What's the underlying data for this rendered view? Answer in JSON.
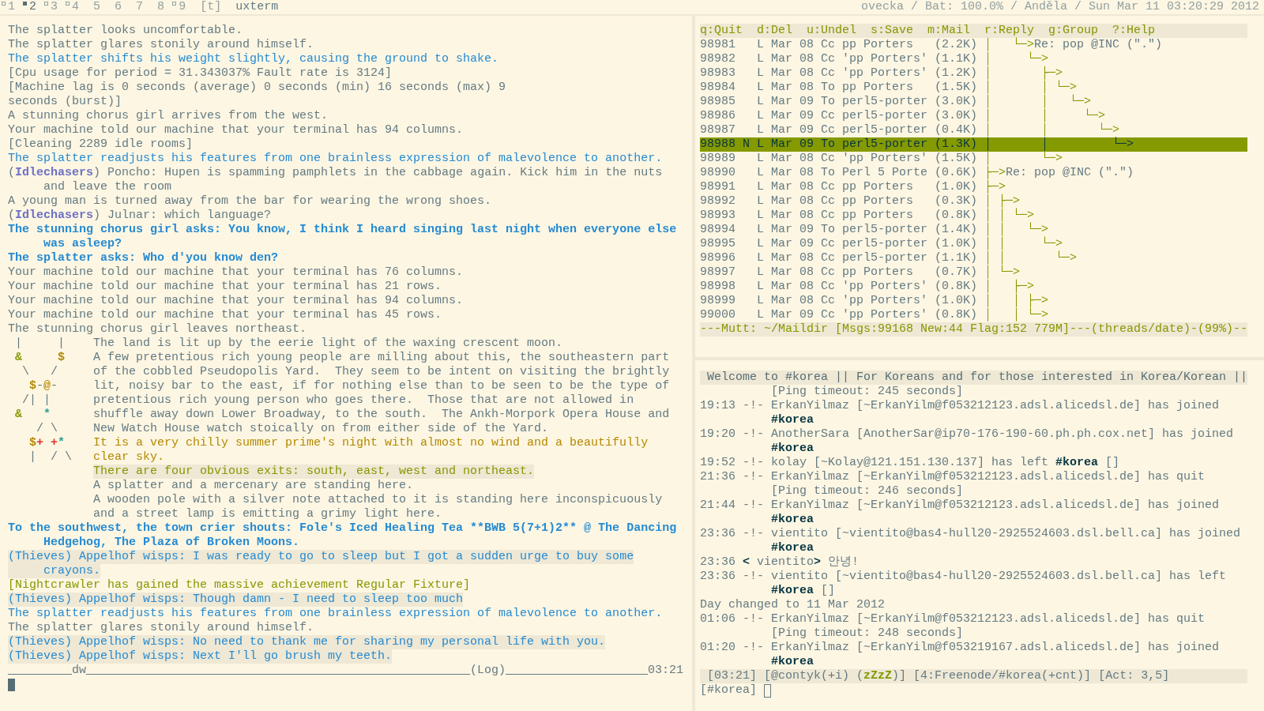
{
  "top_bar": {
    "tags": [
      {
        "label": "1",
        "occupied": true,
        "selected": false
      },
      {
        "label": "2",
        "occupied": true,
        "selected": true
      },
      {
        "label": "3",
        "occupied": true,
        "selected": false
      },
      {
        "label": "4",
        "occupied": true,
        "selected": false
      },
      {
        "label": "5",
        "occupied": false,
        "selected": false
      },
      {
        "label": "6",
        "occupied": false,
        "selected": false
      },
      {
        "label": "7",
        "occupied": false,
        "selected": false
      },
      {
        "label": "8",
        "occupied": false,
        "selected": false
      },
      {
        "label": "9",
        "occupied": true,
        "selected": false
      }
    ],
    "layout": "[t]",
    "title": "uxterm",
    "status": "ovecka / Bat: 100.0% / Anděla / Sun Mar 11 03:20:29 2012"
  },
  "mud": {
    "log": [
      {
        "kind": "plain",
        "lines": [
          "The splatter looks uncomfortable."
        ]
      },
      {
        "kind": "plain",
        "lines": [
          "The splatter glares stonily around himself."
        ]
      },
      {
        "kind": "emote",
        "lines": [
          "The splatter shifts his weight slightly, causing the ground to shake."
        ]
      },
      {
        "kind": "plain",
        "lines": [
          "[Cpu usage for period = 31.343037% Fault rate is 3124]"
        ]
      },
      {
        "kind": "plain",
        "lines": [
          "[Machine lag is 0 seconds (average) 0 seconds (min) 16 seconds (max) 9",
          "seconds (burst)]"
        ]
      },
      {
        "kind": "plain",
        "lines": [
          "A stunning chorus girl arrives from the west."
        ]
      },
      {
        "kind": "plain",
        "lines": [
          "Your machine told our machine that your terminal has 94 columns."
        ]
      },
      {
        "kind": "plain",
        "lines": [
          "[Cleaning 2289 idle rooms]"
        ]
      },
      {
        "kind": "emote",
        "lines": [
          "The splatter readjusts his features from one brainless expression of malevolence to another."
        ]
      },
      {
        "kind": "channel",
        "lines": [
          "(**Idlechasers**) Poncho: Hupen is spamming pamphlets in the cabbage again. Kick him in the nuts",
          "and leave the room"
        ]
      },
      {
        "kind": "plain",
        "lines": [
          "A young man is turned away from the bar for wearing the wrong shoes."
        ]
      },
      {
        "kind": "channel",
        "lines": [
          "(**Idlechasers**) Julnar: which language?"
        ]
      },
      {
        "kind": "speech",
        "lines": [
          "The stunning chorus girl asks: You know, I think I heard singing last night when everyone else",
          "was asleep?"
        ]
      },
      {
        "kind": "speech",
        "lines": [
          "The splatter asks: Who d'you know den?"
        ]
      },
      {
        "kind": "plain",
        "lines": [
          "Your machine told our machine that your terminal has 76 columns."
        ]
      },
      {
        "kind": "plain",
        "lines": [
          "Your machine told our machine that your terminal has 21 rows."
        ]
      },
      {
        "kind": "plain",
        "lines": [
          "Your machine told our machine that your terminal has 94 columns."
        ]
      },
      {
        "kind": "plain",
        "lines": [
          "Your machine told our machine that your terminal has 45 rows."
        ]
      },
      {
        "kind": "plain",
        "lines": [
          "The stunning chorus girl leaves northeast."
        ]
      },
      {
        "kind": "room",
        "map": [
          [
            {
              "text": " |"
            },
            {
              "text": "     |"
            }
          ],
          [
            {
              "text": " &",
              "color": "#859900"
            },
            {
              "text": "     $",
              "color": "#b58900"
            }
          ],
          [
            {
              "text": "  \\"
            },
            {
              "text": "   /"
            }
          ],
          [
            {
              "text": "   $",
              "color": "#b58900"
            },
            {
              "text": "-"
            },
            {
              "text": "@",
              "color": "#b58900"
            },
            {
              "text": "-"
            }
          ],
          [
            {
              "text": "  /"
            },
            {
              "text": "|"
            },
            {
              "text": " |"
            }
          ],
          [
            {
              "text": " &",
              "color": "#859900"
            },
            {
              "text": "   *",
              "color": "#2aa198"
            }
          ],
          [
            {
              "text": "    /"
            },
            {
              "text": " \\"
            }
          ],
          [
            {
              "text": "   $",
              "color": "#b58900"
            },
            {
              "text": "+",
              "color": "#dc322f"
            },
            {
              "text": " +",
              "color": "#dc322f"
            },
            {
              "text": "*",
              "color": "#2aa198"
            }
          ],
          [
            {
              "text": "   |"
            },
            {
              "text": "  /"
            },
            {
              "text": " \\"
            }
          ]
        ],
        "text": [
          {
            "kind": "plain",
            "lines": [
              "The land is lit up by the eerie light of the waxing crescent moon."
            ]
          },
          {
            "kind": "plain",
            "lines": [
              "A few pretentious rich young people are milling about this, the southeastern part",
              "of the cobbled Pseudopolis Yard.  They seem to be intent on visiting the brightly",
              "lit, noisy bar to the east, if for nothing else than to be seen to be the type of",
              "pretentious rich young person who goes there.  Those that are not allowed in",
              "shuffle away down Lower Broadway, to the south.  The Ankh-Morpork Opera House and",
              "New Watch House watch stoically on from either side of the Yard."
            ]
          },
          {
            "kind": "weather",
            "lines": [
              "It is a very chilly summer prime's night with almost no wind and a beautifully",
              "clear sky."
            ]
          },
          {
            "kind": "exits",
            "lines": [
              "There are four obvious exits: south, east, west and northeast."
            ]
          },
          {
            "kind": "plain",
            "lines": [
              "A splatter and a mercenary are standing here."
            ]
          },
          {
            "kind": "plain",
            "lines": [
              "A wooden pole with a silver note attached to it is standing here inconspicuously",
              "and a street lamp is emitting a grimy light here."
            ]
          }
        ]
      },
      {
        "kind": "speech",
        "lines": [
          "To the southwest, the town crier shouts: Fole's Iced Healing Tea **BWB 5(7+1)2** @ The Dancing",
          "Hedgehog, The Plaza of Broken Moons."
        ]
      },
      {
        "kind": "wisp",
        "lines": [
          "(Thieves) Appelhof wisps: I was ready to go to sleep but I got a sudden urge to buy some",
          "crayons."
        ]
      },
      {
        "kind": "achievement",
        "lines": [
          "[Nightcrawler has gained the massive achievement Regular Fixture]"
        ]
      },
      {
        "kind": "wisp",
        "lines": [
          "(Thieves) Appelhof wisps: Though damn - I need to sleep too much"
        ]
      },
      {
        "kind": "emote",
        "lines": [
          "The splatter readjusts his features from one brainless expression of malevolence to another."
        ]
      },
      {
        "kind": "plain",
        "lines": [
          "The splatter glares stonily around himself."
        ]
      },
      {
        "kind": "wisp",
        "lines": [
          "(Thieves) Appelhof wisps: No need to thank me for sharing my personal life with you."
        ]
      },
      {
        "kind": "wisp",
        "lines": [
          "(Thieves) Appelhof wisps: Next I'll go brush my teeth."
        ]
      }
    ],
    "status_line": {
      "session": "dw",
      "log": "(Log)",
      "time": "03:21"
    }
  },
  "mutt": {
    "help": [
      "q:Quit",
      "d:Del",
      "u:Undel",
      "s:Save",
      "m:Mail",
      "r:Reply",
      "g:Group",
      "?:Help"
    ],
    "rows": [
      {
        "number": "98981",
        "status": "L",
        "date": "Mar 08",
        "recipient": "Cc",
        "author": "pp Porters",
        "size": "(2.2K)",
        "tree": "│   └─>",
        "subject": "Re: pop @INC (\".\")",
        "selected": false
      },
      {
        "number": "98982",
        "status": "L",
        "date": "Mar 08",
        "recipient": "Cc",
        "author": "'pp Porters'",
        "size": "(1.1K)",
        "tree": "│     └─>",
        "selected": false
      },
      {
        "number": "98983",
        "status": "L",
        "date": "Mar 08",
        "recipient": "Cc",
        "author": "'pp Porters'",
        "size": "(1.2K)",
        "tree": "│       ├─>",
        "selected": false
      },
      {
        "number": "98984",
        "status": "L",
        "date": "Mar 08",
        "recipient": "To",
        "author": "pp Porters",
        "size": "(1.5K)",
        "tree": "│       │ └─>",
        "selected": false
      },
      {
        "number": "98985",
        "status": "L",
        "date": "Mar 09",
        "recipient": "To",
        "author": "perl5-porter",
        "size": "(3.0K)",
        "tree": "│       │   └─>",
        "selected": false
      },
      {
        "number": "98986",
        "status": "L",
        "date": "Mar 09",
        "recipient": "Cc",
        "author": "perl5-porter",
        "size": "(3.0K)",
        "tree": "│       │     └─>",
        "selected": false
      },
      {
        "number": "98987",
        "status": "L",
        "date": "Mar 09",
        "recipient": "Cc",
        "author": "perl5-porter",
        "size": "(0.4K)",
        "tree": "│       │       └─>",
        "selected": false
      },
      {
        "number": "98988",
        "flag": "N",
        "status": "L",
        "date": "Mar 09",
        "recipient": "To",
        "author": "perl5-porter",
        "size": "(1.3K)",
        "tree": "│       │         └─>",
        "selected": true
      },
      {
        "number": "98989",
        "status": "L",
        "date": "Mar 08",
        "recipient": "Cc",
        "author": "'pp Porters'",
        "size": "(1.5K)",
        "tree": "│       └─>",
        "selected": false
      },
      {
        "number": "98990",
        "status": "L",
        "date": "Mar 08",
        "recipient": "To",
        "author": "Perl 5 Porte",
        "size": "(0.6K)",
        "tree": "├─>",
        "subject": "Re: pop @INC (\".\")",
        "selected": false
      },
      {
        "number": "98991",
        "status": "L",
        "date": "Mar 08",
        "recipient": "Cc",
        "author": "pp Porters",
        "size": "(1.0K)",
        "tree": "├─>",
        "selected": false
      },
      {
        "number": "98992",
        "status": "L",
        "date": "Mar 08",
        "recipient": "Cc",
        "author": "pp Porters",
        "size": "(0.3K)",
        "tree": "│ ├─>",
        "selected": false
      },
      {
        "number": "98993",
        "status": "L",
        "date": "Mar 08",
        "recipient": "Cc",
        "author": "pp Porters",
        "size": "(0.8K)",
        "tree": "│ │ └─>",
        "selected": false
      },
      {
        "number": "98994",
        "status": "L",
        "date": "Mar 09",
        "recipient": "To",
        "author": "perl5-porter",
        "size": "(1.4K)",
        "tree": "│ │   └─>",
        "selected": false
      },
      {
        "number": "98995",
        "status": "L",
        "date": "Mar 09",
        "recipient": "Cc",
        "author": "perl5-porter",
        "size": "(1.0K)",
        "tree": "│ │     └─>",
        "selected": false
      },
      {
        "number": "98996",
        "status": "L",
        "date": "Mar 08",
        "recipient": "Cc",
        "author": "perl5-porter",
        "size": "(1.1K)",
        "tree": "│ │       └─>",
        "selected": false
      },
      {
        "number": "98997",
        "status": "L",
        "date": "Mar 08",
        "recipient": "Cc",
        "author": "pp Porters",
        "size": "(0.7K)",
        "tree": "│ └─>",
        "selected": false
      },
      {
        "number": "98998",
        "status": "L",
        "date": "Mar 08",
        "recipient": "Cc",
        "author": "'pp Porters'",
        "size": "(0.8K)",
        "tree": "│   ├─>",
        "selected": false
      },
      {
        "number": "98999",
        "status": "L",
        "date": "Mar 08",
        "recipient": "Cc",
        "author": "'pp Porters'",
        "size": "(1.0K)",
        "tree": "│   │ ├─>",
        "selected": false
      },
      {
        "number": "99000",
        "status": "L",
        "date": "Mar 09",
        "recipient": "Cc",
        "author": "'pp Porters'",
        "size": "(0.8K)",
        "tree": "│   │ └─>",
        "selected": false
      }
    ],
    "status": "---Mutt: ~/Maildir [Msgs:99168 New:44 Flag:152 779M]---(threads/date)-(99%)--"
  },
  "irc": {
    "topic": "Welcome to #korea || For Koreans and for those interested in Korea/Korean ||",
    "lines": [
      {
        "wrap": "[Ping timeout: 245 seconds]"
      },
      {
        "time": "19:13",
        "text": "-!- ErkanYilmaz [~ErkanYilm@f053212123.adsl.alicedsl.de] has joined",
        "wrap": "**#korea**"
      },
      {
        "time": "19:20",
        "text": "-!- AnotherSara [AnotherSar@ip70-176-190-60.ph.ph.cox.net] has joined",
        "wrap": "**#korea**"
      },
      {
        "time": "19:52",
        "text": "-!- kolay [~Kolay@121.151.130.137] has left **#korea** []"
      },
      {
        "time": "21:36",
        "text": "-!- ErkanYilmaz [~ErkanYilm@f053212123.adsl.alicedsl.de] has quit",
        "wrap": "[Ping timeout: 246 seconds]"
      },
      {
        "time": "21:44",
        "text": "-!- ErkanYilmaz [~ErkanYilm@f053212123.adsl.alicedsl.de] has joined",
        "wrap": "**#korea**"
      },
      {
        "time": "23:36",
        "text": "-!- vientito [~vientito@bas4-hull20-2925524603.dsl.bell.ca] has joined",
        "wrap": "**#korea**"
      },
      {
        "time": "23:36",
        "text": "**<** vientito**>** 안녕!"
      },
      {
        "time": "23:36",
        "text": "-!- vientito [~vientito@bas4-hull20-2925524603.dsl.bell.ca] has left",
        "wrap": "**#korea** []"
      },
      {
        "text": "Day changed to 11 Mar 2012"
      },
      {
        "time": "01:06",
        "text": "-!- ErkanYilmaz [~ErkanYilm@f053212123.adsl.alicedsl.de] has quit",
        "wrap": "[Ping timeout: 248 seconds]"
      },
      {
        "time": "01:20",
        "text": "-!- ErkanYilmaz [~ErkanYilm@f053219167.adsl.alicedsl.de] has joined",
        "wrap": "**#korea**"
      }
    ],
    "status": [
      "[03:21]",
      "[@contyk(+i) (**zZzZ**)]",
      "[4:Freenode/#korea(+cnt)]",
      "[Act: 3,5]"
    ],
    "prompt": "[#korea]"
  }
}
